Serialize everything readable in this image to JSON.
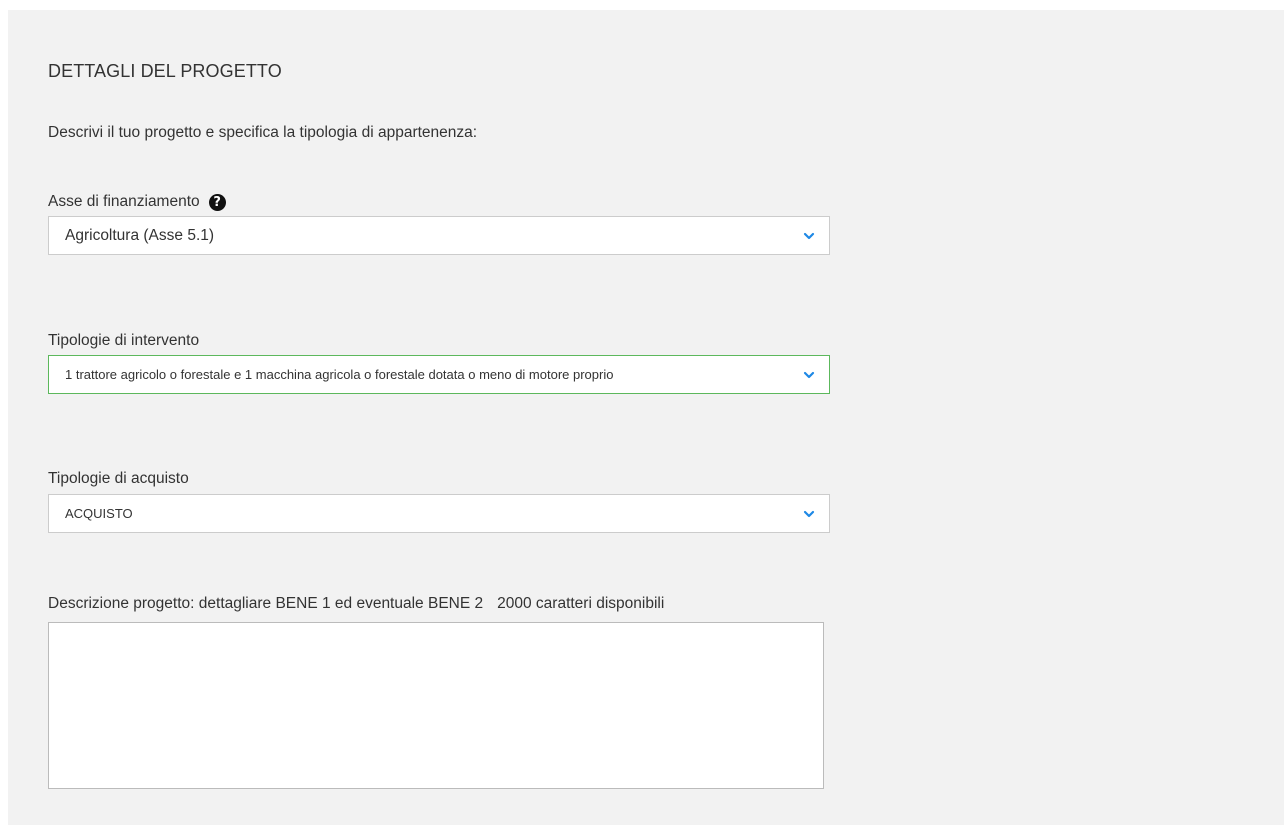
{
  "section": {
    "title": "DETTAGLI DEL PROGETTO",
    "intro": "Descrivi il tuo progetto e specifica la tipologia di appartenenza:"
  },
  "asse": {
    "label": "Asse di finanziamento",
    "help_icon": "question-circle-icon",
    "value": "Agricoltura (Asse 5.1)"
  },
  "intervento": {
    "label": "Tipologie di intervento",
    "value": "1 trattore agricolo o forestale e 1 macchina agricola o forestale dotata o meno di motore proprio"
  },
  "acquisto": {
    "label": "Tipologie di acquisto",
    "value": "ACQUISTO"
  },
  "descrizione": {
    "label": "Descrizione progetto: dettagliare BENE 1 ed eventuale BENE 2",
    "counter": "2000 caratteri disponibili",
    "value": ""
  },
  "colors": {
    "panel_bg": "#f2f2f2",
    "chevron": "#1e88e5",
    "active_border": "#5cb85c"
  }
}
